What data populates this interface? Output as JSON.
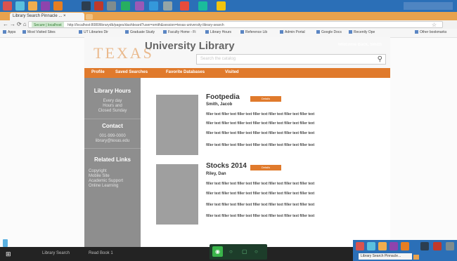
{
  "browser": {
    "tab_title": "Library Search Pinnacle ... ×",
    "address_secure": "Secure | localhost",
    "address_url": "http://localhost:8080/librarydb/pages/dashboard?user=smith&session=texas-university-library-search",
    "bookmarks": [
      "Apps",
      "Most Visited Sites",
      "UT Libraries Dir",
      "Graduate Study",
      "Faculty Home - Fi",
      "Library Hours",
      "Reference Lib",
      "Admin Portal",
      "Google Docs",
      "Recently Ope",
      "Other bookmarks"
    ]
  },
  "site": {
    "logo": "TEXAS",
    "title": "University Library",
    "welcome": "Welcome Back, Smith",
    "search_placeholder": "Search the catalog",
    "nav": [
      "Profile",
      "Saved Searches",
      "Favorite Databases",
      "Visited"
    ]
  },
  "sidebar": {
    "hours_heading": "Library Hours",
    "hours_lines": [
      "Every day",
      "Hours and",
      "Closed Sunday"
    ],
    "contact_heading": "Contact",
    "contact_lines": [
      "001-999-0000",
      "library@texas.edu"
    ],
    "links_heading": "Related Links",
    "links": [
      "Copyright",
      "Mobile Site",
      "Academic Support",
      "Online Learning"
    ]
  },
  "items": [
    {
      "title": "Footpedia",
      "author": "Smith, Jacob",
      "button": "Details",
      "lines": [
        "filler text filler text filler text filler text filler text filler text filler text",
        "filler text filler text filler text filler text filler text filler text filler text",
        "filler text filler text filler text filler text filler text filler text filler text",
        "filler text filler text filler text filler text filler text filler text filler text"
      ]
    },
    {
      "title": "Stocks 2014",
      "author": "Riley, Dan",
      "button": "Details",
      "lines": [
        "filler text filler text filler text filler text filler text filler text filler text",
        "filler text filler text filler text filler text filler text filler text filler text",
        "filler text filler text filler text filler text filler text filler text filler text",
        "filler text filler text filler text filler text filler text filler text filler text"
      ]
    }
  ],
  "taskbar": {
    "items": [
      "Library Search",
      "Read Book 1"
    ],
    "overlay_tab": "Library Search Pinnacle..."
  },
  "colors": {
    "accent": "#e07a2c",
    "taskbar": "#2b6fb7",
    "sidebar": "#8e8e8e"
  }
}
